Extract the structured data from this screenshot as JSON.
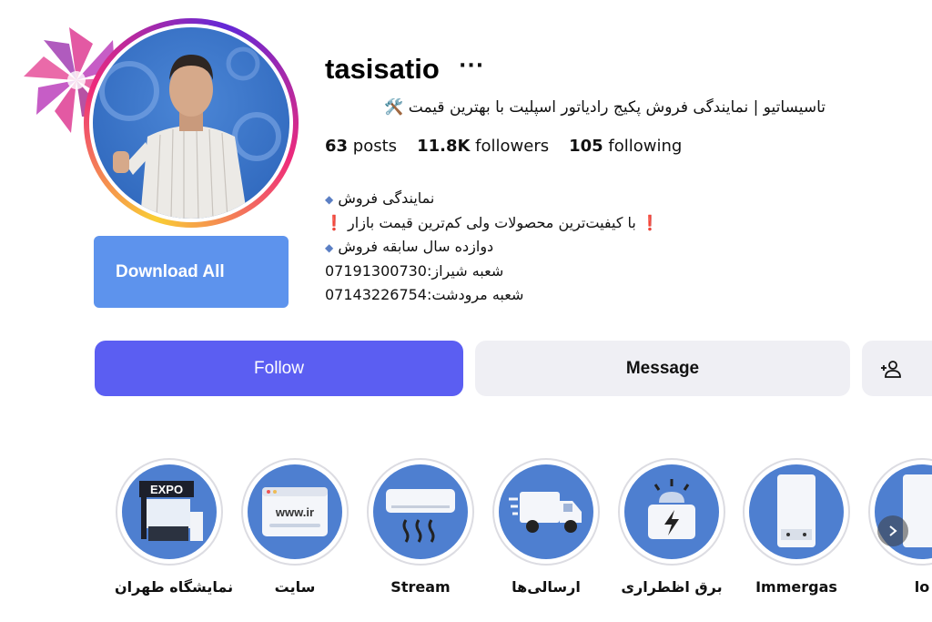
{
  "profile": {
    "username": "tasisatio",
    "more_label": "···",
    "headline": "تاسیساتیو | نمایندگی فروش پکیج رادیاتور اسپلیت با بهترین قیمت 🛠️",
    "stats": {
      "posts_count": "63",
      "posts_label": "posts",
      "followers_count": "11.8K",
      "followers_label": "followers",
      "following_count": "105",
      "following_label": "following"
    },
    "bio": {
      "line1": "نمایندگی فروش",
      "line2": "با کیفیت‌ترین محصولات ولی کم‌ترین قیمت بازار",
      "line3": "دوازده سال سابقه فروش",
      "line4": "شعبه شیراز:07191300730",
      "line5": "شعبه مرودشت:07143226754"
    }
  },
  "actions": {
    "download_all": "Download All",
    "follow": "Follow",
    "message": "Message"
  },
  "highlights": [
    {
      "label": "نمایشگاه طهران",
      "icon": "expo-booth-icon",
      "sign": "EXPO"
    },
    {
      "label": "سایت",
      "icon": "website-icon",
      "sign": "www.ir"
    },
    {
      "label": "Stream",
      "icon": "air-conditioner-icon"
    },
    {
      "label": "ارسالی‌ها",
      "icon": "delivery-truck-icon"
    },
    {
      "label": "برق اظطراری",
      "icon": "emergency-power-icon"
    },
    {
      "label": "Immergas",
      "icon": "boiler-icon"
    },
    {
      "label": "lo",
      "icon": "boiler-icon"
    }
  ],
  "colors": {
    "follow": "#5b5ef2",
    "download": "#5d93ed",
    "message_bg": "#efeff4",
    "highlight_bg": "#4e7fd0"
  }
}
